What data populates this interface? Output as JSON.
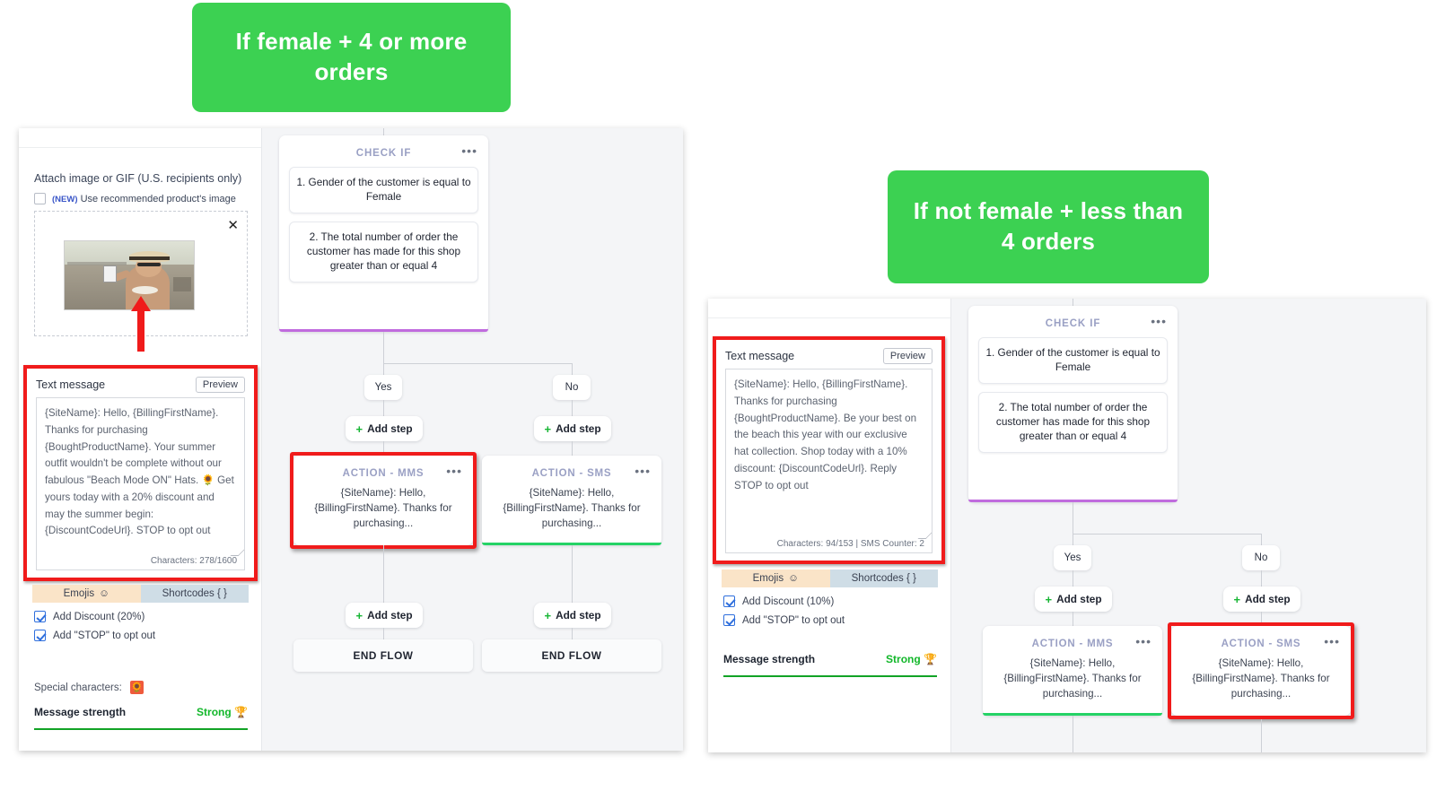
{
  "banners": {
    "left": "If female + 4 or more orders",
    "right": "If not female + less than 4 orders"
  },
  "colors": {
    "banner_green": "#3cd152",
    "highlight_red": "#f01b1b",
    "accent_purple": "#9aa0c4",
    "bar_purple": "#c06bde",
    "bar_green": "#25d366",
    "strong_green": "#12b72a",
    "emojis_tab": "#fae4c8",
    "shortcodes_tab": "#cfdde6",
    "canvas_bg": "#f4f5f7"
  },
  "left_shot": {
    "attach": {
      "label": "Attach image or GIF (U.S. recipients only)",
      "new_tag": "(NEW)",
      "recommended_label": "Use recommended product's image",
      "recommended_checked": false,
      "close_icon": "✕"
    },
    "text_message": {
      "title": "Text message",
      "preview_label": "Preview",
      "body": "{SiteName}: Hello, {BillingFirstName}. Thanks for purchasing {BoughtProductName}. Your summer outfit wouldn't be complete without our fabulous \"Beach Mode ON\" Hats. 🌻 Get yours today with a 20% discount and may the summer begin: {DiscountCodeUrl}. STOP to opt out",
      "counter": "Characters: 278/1600"
    },
    "tabs": {
      "emojis": "Emojis",
      "emojis_icon": "☺",
      "shortcodes": "Shortcodes { }"
    },
    "options": [
      {
        "label": "Add Discount (20%)",
        "checked": true
      },
      {
        "label": "Add \"STOP\" to opt out",
        "checked": true
      }
    ],
    "special_characters": {
      "label": "Special characters:",
      "glyph": "🌻"
    },
    "strength": {
      "label": "Message strength",
      "value": "Strong",
      "trophy": "🏆"
    },
    "flow": {
      "check_title": "CHECK IF",
      "menu_icon": "•••",
      "conditions": [
        "1. Gender of the customer is equal to Female",
        "2. The total number of order the customer has made for this shop greater than or equal 4"
      ],
      "branch_yes": "Yes",
      "branch_no": "No",
      "add_step": "Add step",
      "add_step_plus": "+",
      "actions": [
        {
          "title": "ACTION - MMS",
          "body": "{SiteName}: Hello, {BillingFirstName}. Thanks for purchasing...",
          "highlighted": true,
          "bar": "none"
        },
        {
          "title": "ACTION - SMS",
          "body": "{SiteName}: Hello, {BillingFirstName}. Thanks for purchasing...",
          "highlighted": false,
          "bar": "green"
        }
      ],
      "end_flow": "END FLOW"
    }
  },
  "right_shot": {
    "text_message": {
      "title": "Text message",
      "preview_label": "Preview",
      "body": "{SiteName}: Hello, {BillingFirstName}. Thanks for purchasing {BoughtProductName}. Be your best on the beach this year with our exclusive hat collection. Shop today with a 10% discount: {DiscountCodeUrl}. Reply STOP to opt out",
      "counter": "Characters: 94/153 | SMS Counter: 2"
    },
    "tabs": {
      "emojis": "Emojis",
      "emojis_icon": "☺",
      "shortcodes": "Shortcodes { }"
    },
    "options": [
      {
        "label": "Add Discount (10%)",
        "checked": true
      },
      {
        "label": "Add \"STOP\" to opt out",
        "checked": true
      }
    ],
    "strength": {
      "label": "Message strength",
      "value": "Strong",
      "trophy": "🏆"
    },
    "flow": {
      "check_title": "CHECK IF",
      "menu_icon": "•••",
      "conditions": [
        "1. Gender of the customer is equal to Female",
        "2. The total number of order the customer has made for this shop greater than or equal 4"
      ],
      "branch_yes": "Yes",
      "branch_no": "No",
      "add_step": "Add step",
      "add_step_plus": "+",
      "actions": [
        {
          "title": "ACTION - MMS",
          "body": "{SiteName}: Hello, {BillingFirstName}. Thanks for purchasing...",
          "highlighted": false,
          "bar": "green"
        },
        {
          "title": "ACTION - SMS",
          "body": "{SiteName}: Hello, {BillingFirstName}. Thanks for purchasing...",
          "highlighted": true,
          "bar": "none"
        }
      ]
    }
  }
}
